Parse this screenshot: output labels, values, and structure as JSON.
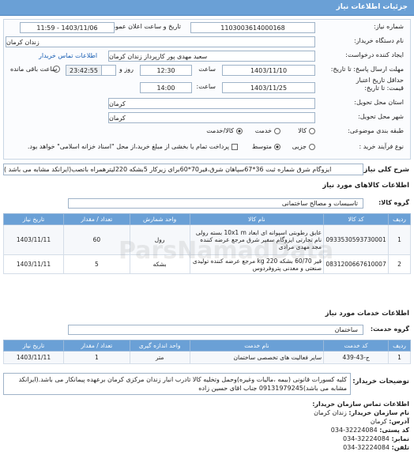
{
  "header": {
    "title": "جزئیات اطلاعات نیاز"
  },
  "info": {
    "need_number_label": "شماره نیاز:",
    "need_number": "1103003614000168",
    "announce_label": "تاریخ و ساعت اعلان عمومی:",
    "announce_value": "1403/11/06 - 11:59",
    "buyer_org_label": "نام دستگاه خریدار:",
    "buyer_org": "زندان کرمان",
    "creator_label": "ایجاد کننده درخواست:",
    "creator": "سعید مهدی پور کارپرداز زندان کرمان",
    "contact_link": "اطلاعات تماس خریدار",
    "reply_deadline_label": "مهلت ارسال پاسخ: تا تاریخ:",
    "reply_date": "1403/11/10",
    "time_label": "ساعت",
    "reply_time": "12:30",
    "days_value": "3",
    "days_label": "روز و",
    "remaining_time": "23:42:55",
    "remaining_label": "ساعت باقی مانده",
    "min_validity_label": "حداقل تاریخ اعتبار",
    "min_validity_label2": "قیمت: تا تاریخ:",
    "validity_date": "1403/11/25",
    "validity_time_label": "ساعت:",
    "validity_time": "14:00",
    "province_label": "استان محل تحویل:",
    "province": "کرمان",
    "city_label": "شهر محل تحویل:",
    "city": "کرمان",
    "category_label": "طبقه بندی موضوعی:",
    "category_opt1": "کالا",
    "category_opt2": "خدمت",
    "category_opt3": "کالا/خدمت",
    "purchase_label": "نوع فرآیند خرید :",
    "purchase_opt1": "جزیی",
    "purchase_opt2": "متوسط",
    "payment_text": "پرداخت تمام یا بخشی از مبلغ خرید،از محل \"اسناد خزانه اسلامی\" خواهد بود."
  },
  "general_desc": {
    "label": "شرح کلی نیاز:",
    "text": "ایزوگام شرق شماره ثبت 36*67سپاهان شرق،قیر70*60برای زیرکار 5بشکه 220لیترهمراه باتصب(ایرانکد مشابه می باشد )"
  },
  "goods_section": {
    "title": "اطلاعات کالاهای مورد نیاز",
    "group_label": "گروه کالا:",
    "group_value": "تاسیسات و مصالح ساختمانی",
    "headers": [
      "ردیف",
      "کد کالا",
      "نام کالا",
      "واحد شمارش",
      "تعداد / مقدار",
      "تاریخ نیاز"
    ],
    "rows": [
      {
        "index": "1",
        "code": "0933530593730001",
        "name": "عایق رطوبتی اسپوانه ای ابعاد 10x1 m بسته رولی نام تجارتی ایزوگام سفیر شرق مرجع عرضه کننده مجد مهدی مرادی",
        "unit": "رول",
        "qty": "60",
        "date": "1403/11/11"
      },
      {
        "index": "2",
        "code": "0831200667610007",
        "name": "قیر 60/70 بشکه 220 kg مرجع عرضه کننده تولیدی صنعتی و معدنی پتروفردوس",
        "unit": "بشکه",
        "qty": "5",
        "date": "1403/11/11"
      }
    ]
  },
  "services_section": {
    "title": "اطلاعات خدمات مورد نیاز",
    "group_label": "گروه خدمت:",
    "group_value": "ساختمان",
    "headers": [
      "ردیف",
      "کد خدمت",
      "نام خدمت",
      "واحد اندازه گیری",
      "تعداد / مقدار",
      "تاریخ نیاز"
    ],
    "rows": [
      {
        "index": "1",
        "code": "ج-43-439",
        "name": "سایر فعالیت های تخصصی ساختمان",
        "unit": "متر",
        "qty": "1",
        "date": "1403/11/11"
      }
    ]
  },
  "buyer_notes": {
    "label": "توضیحات خریدار:",
    "text": "کلیه کسورات قانونی (بیمه ،مالیات وغیره)وحمل وتخلیه کالا تادرب انبار زندان مرکزی کرمان برعهده پیمانکار می باشد.(ایرانکد مشابه می باشد)09131979245 جناب اقای حسین زاده"
  },
  "buyer_contact": {
    "title": "اطلاعات تماس سازمان خریدار:",
    "org_label": "نام سازمان خریدار:",
    "org": "زندان کرمان",
    "address_label": "آدرس:",
    "address": "کرمان",
    "postal_label": "کد پستی:",
    "postal": "32224084-034",
    "fax_label": "نمابر:",
    "fax": "32224084-034",
    "phone_label": "تلفن:",
    "phone": "32224084-034",
    "footer_label": "اطلاعات ایجاد کننده درخواست:"
  },
  "watermark": {
    "text": "ParsNamadData"
  }
}
